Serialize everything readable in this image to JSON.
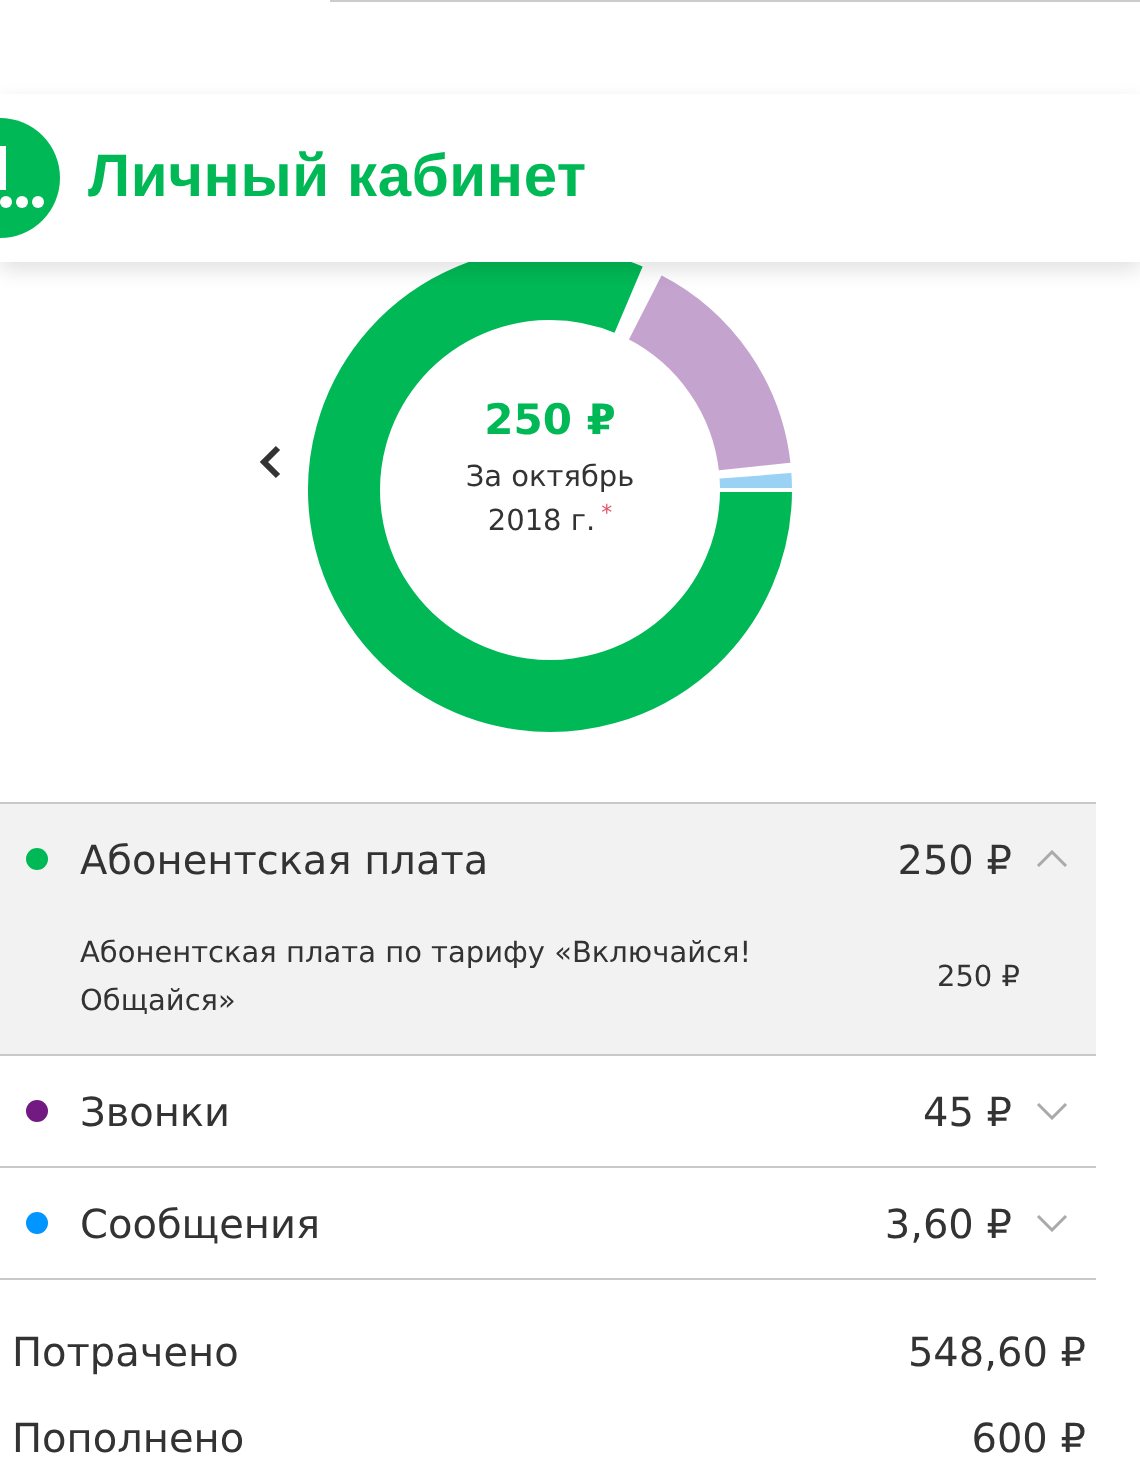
{
  "header": {
    "title": "Личный кабинет"
  },
  "summary": {
    "amount": "250 ₽",
    "period": "За октябрь",
    "year": "2018 г.",
    "footnote_mark": "*"
  },
  "charges": [
    {
      "name": "Абонентская плата",
      "amount": "250 ₽",
      "color": "#00b956",
      "expanded": true,
      "details": [
        {
          "text": "Абонентская плата по тарифу «Включайся! Общайся»",
          "amount": "250 ₽"
        }
      ]
    },
    {
      "name": "Звонки",
      "amount": "45 ₽",
      "color": "#731982",
      "expanded": false
    },
    {
      "name": "Сообщения",
      "amount": "3,60 ₽",
      "color": "#0095ff",
      "expanded": false
    }
  ],
  "totals": [
    {
      "label": "Потрачено",
      "amount": "548,60 ₽"
    },
    {
      "label": "Пополнено",
      "amount": "600 ₽"
    }
  ]
}
